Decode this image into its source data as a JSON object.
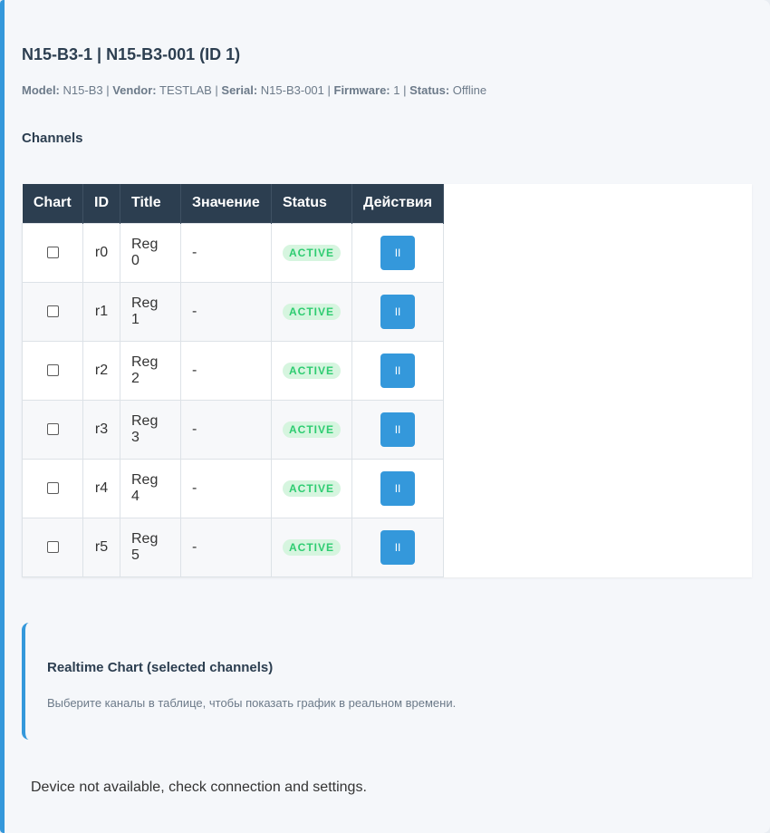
{
  "device": {
    "title": "N15-B3-1 | N15-B3-001 (ID 1)",
    "model_label": "Model:",
    "model": "N15-B3",
    "vendor_label": "Vendor:",
    "vendor": "TESTLAB",
    "serial_label": "Serial:",
    "serial": "N15-B3-001",
    "firmware_label": "Firmware:",
    "firmware": "1",
    "status_label": "Status:",
    "status": "Offline"
  },
  "channels": {
    "section_title": "Channels",
    "columns": [
      "Chart",
      "ID",
      "Title",
      "Значение",
      "Status",
      "Действия"
    ],
    "rows": [
      {
        "id": "r0",
        "title": "Reg 0",
        "value": "-",
        "status": "ACTIVE",
        "action": "II",
        "checked": false
      },
      {
        "id": "r1",
        "title": "Reg 1",
        "value": "-",
        "status": "ACTIVE",
        "action": "II",
        "checked": false
      },
      {
        "id": "r2",
        "title": "Reg 2",
        "value": "-",
        "status": "ACTIVE",
        "action": "II",
        "checked": false
      },
      {
        "id": "r3",
        "title": "Reg 3",
        "value": "-",
        "status": "ACTIVE",
        "action": "II",
        "checked": false
      },
      {
        "id": "r4",
        "title": "Reg 4",
        "value": "-",
        "status": "ACTIVE",
        "action": "II",
        "checked": false
      },
      {
        "id": "r5",
        "title": "Reg 5",
        "value": "-",
        "status": "ACTIVE",
        "action": "II",
        "checked": false
      }
    ]
  },
  "realtime_chart": {
    "title": "Realtime Chart (selected channels)",
    "hint": "Выберите каналы в таблице, чтобы показать график в реальном времени."
  },
  "footer": {
    "message": "Device not available, check connection and settings."
  },
  "colors": {
    "accent": "#3498db",
    "header_bg": "#2c3e50",
    "active_text": "#2ecc71",
    "active_bg": "#d6f5df"
  },
  "icons": {
    "action": "pause-icon"
  }
}
